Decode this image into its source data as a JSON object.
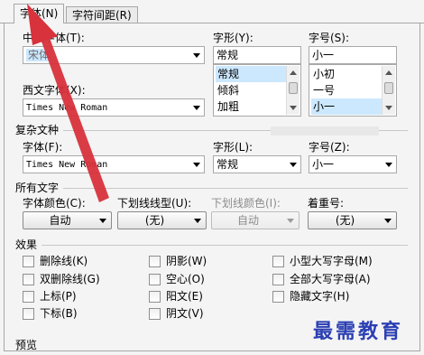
{
  "tabs": [
    {
      "label": "字体(N)"
    },
    {
      "label": "字符间距(R)"
    }
  ],
  "chinese_font": {
    "label": "中文字体(T):",
    "value": "宋体"
  },
  "font_style": {
    "label": "字形(Y):",
    "value": "常规",
    "items": [
      "常规",
      "倾斜",
      "加粗"
    ]
  },
  "font_size": {
    "label": "字号(S):",
    "value": "小一",
    "items": [
      "小初",
      "一号",
      "小一"
    ]
  },
  "western_font": {
    "label": "西文字体(X):",
    "value": "Times New Roman"
  },
  "complex_script": {
    "group_label": "复杂文种",
    "font_label": "字体(F):",
    "font_value": "Times New Roman",
    "style_label": "字形(L):",
    "style_value": "常规",
    "size_label": "字号(Z):",
    "size_value": "小一"
  },
  "all_text": {
    "group_label": "所有文字",
    "font_color_label": "字体颜色(C):",
    "font_color_value": "自动",
    "underline_type_label": "下划线线型(U):",
    "underline_type_value": "(无)",
    "underline_color_label": "下划线颜色(I):",
    "underline_color_value": "自动",
    "emphasis_label": "着重号:",
    "emphasis_value": "(无)"
  },
  "effects": {
    "group_label": "效果",
    "items": [
      {
        "label": "删除线(K)"
      },
      {
        "label": "双删除线(G)"
      },
      {
        "label": "上标(P)"
      },
      {
        "label": "下标(B)"
      },
      {
        "label": "阴影(W)"
      },
      {
        "label": "空心(O)"
      },
      {
        "label": "阳文(E)"
      },
      {
        "label": "阴文(V)"
      },
      {
        "label": "小型大写字母(M)"
      },
      {
        "label": "全部大写字母(A)"
      },
      {
        "label": "隐藏文字(H)"
      }
    ]
  },
  "preview": {
    "group_label": "预览"
  },
  "watermark": {
    "text": "最需教育"
  },
  "colors": {
    "annotation_arrow": "#d8323c",
    "selection": "#cce8ff",
    "watermark": "#2b3fb3"
  }
}
